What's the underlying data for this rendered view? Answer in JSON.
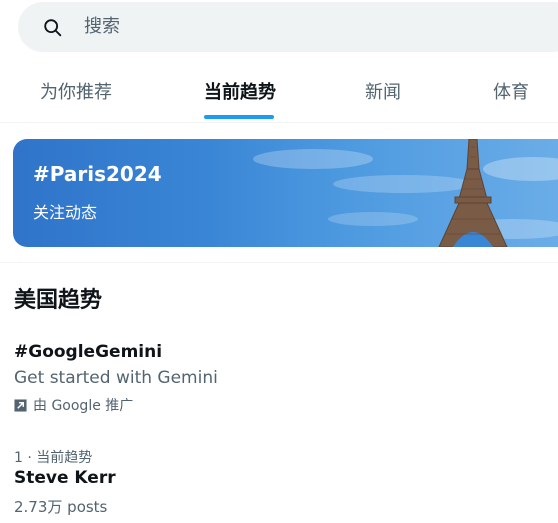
{
  "search": {
    "placeholder": "搜索",
    "icon": "search-icon"
  },
  "tabs": [
    {
      "label": "为你推荐",
      "active": false
    },
    {
      "label": "当前趋势",
      "active": true
    },
    {
      "label": "新闻",
      "active": false
    },
    {
      "label": "体育",
      "active": false
    }
  ],
  "accent_color": "#1d9bf0",
  "banner": {
    "hashtag": "#Paris2024",
    "subtitle": "关注动态"
  },
  "section": {
    "title": "美国趋势"
  },
  "trends": [
    {
      "title": "#GoogleGemini",
      "description": "Get started with Gemini",
      "promoted": "由 Google 推广"
    },
    {
      "context": "1 · 当前趋势",
      "title": "Steve Kerr",
      "count": "2.73万 posts"
    }
  ]
}
